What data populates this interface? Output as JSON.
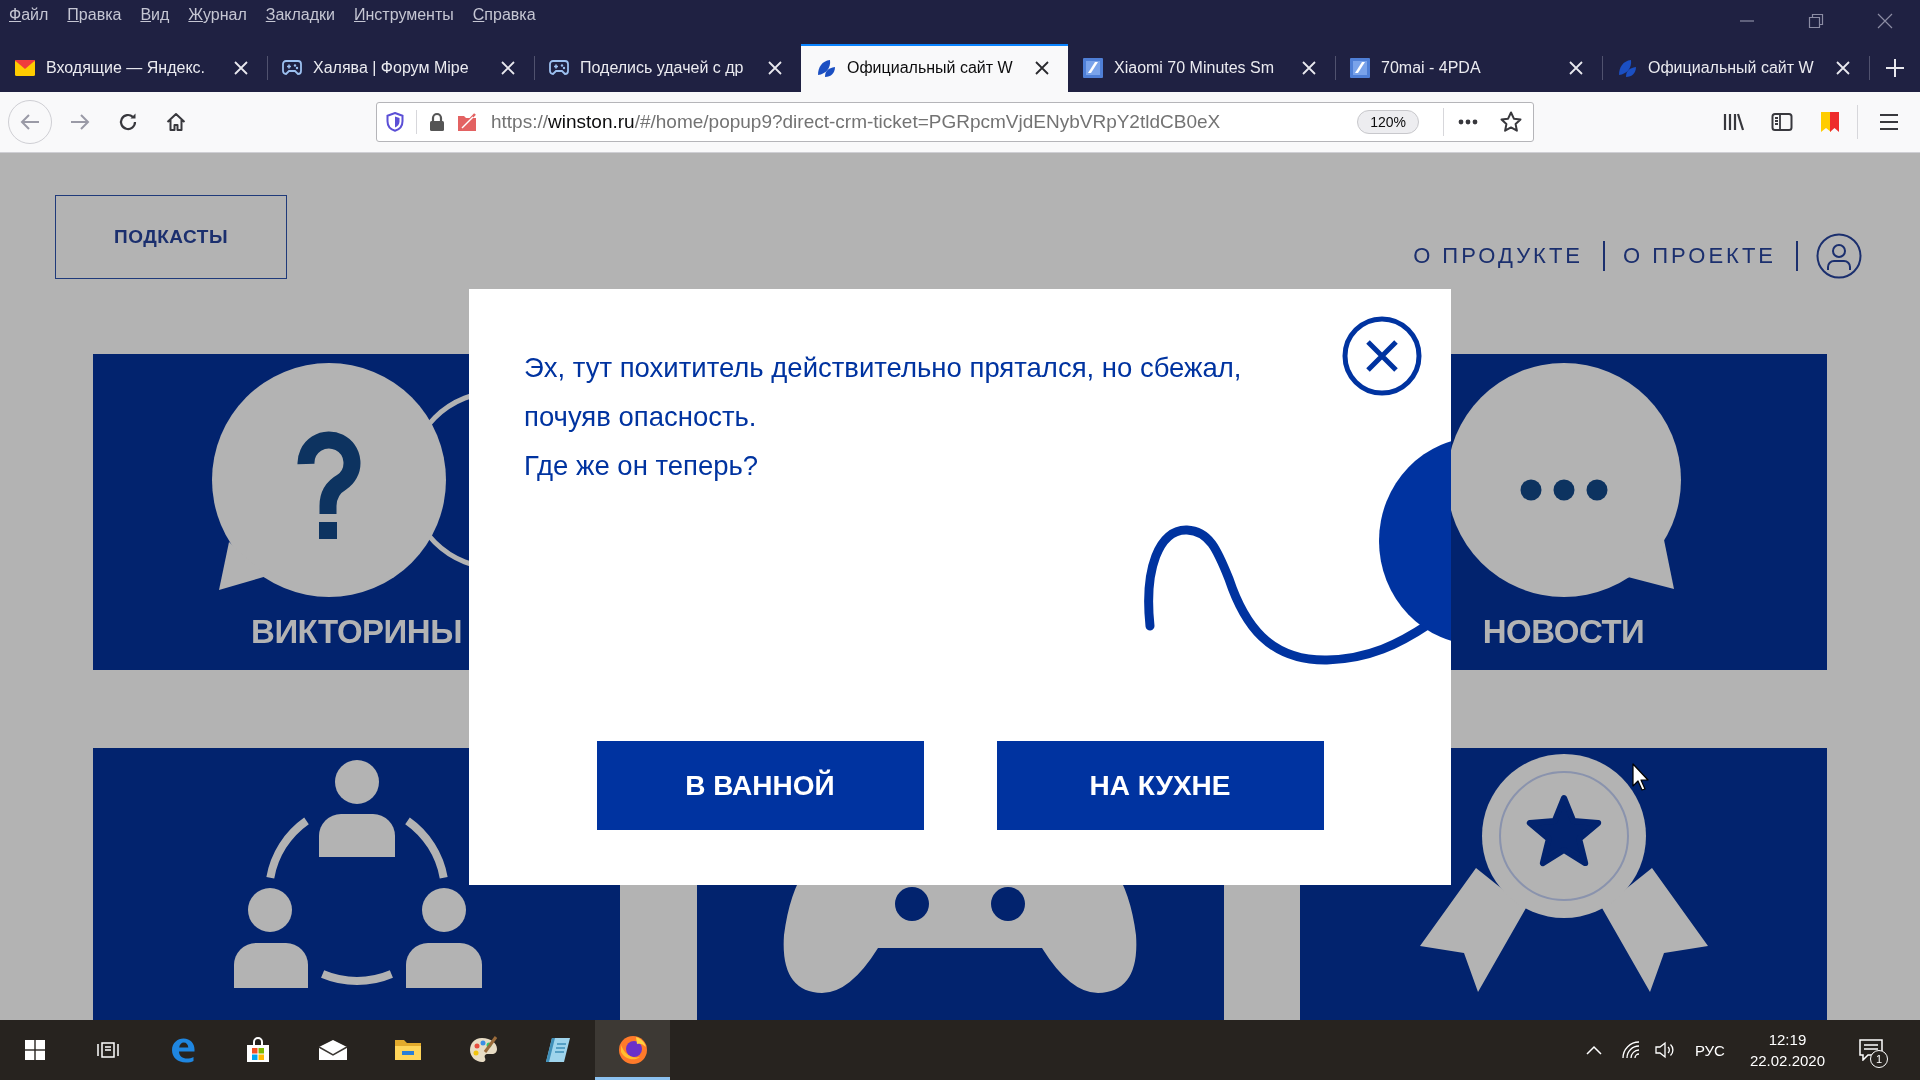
{
  "menu_bar": {
    "items": [
      "Файл",
      "Правка",
      "Вид",
      "Журнал",
      "Закладки",
      "Инструменты",
      "Справка"
    ]
  },
  "tabs": [
    {
      "title": "Входящие — Яндекс.",
      "kind": "mail",
      "selected": false
    },
    {
      "title": "Халява | Форум Mipe",
      "kind": "gamepad",
      "selected": false
    },
    {
      "title": "Поделись удачей с др",
      "kind": "gamepad",
      "selected": false
    },
    {
      "title": "Официальный сайт W",
      "kind": "leaf",
      "selected": true
    },
    {
      "title": "Xiaomi 70 Minutes Sm",
      "kind": "tile",
      "selected": false
    },
    {
      "title": "70mai - 4PDA",
      "kind": "tile",
      "selected": false
    },
    {
      "title": "Официальный сайт W",
      "kind": "leaf",
      "selected": false
    }
  ],
  "toolbar": {
    "url": {
      "scheme": "https://",
      "host": "winston.ru",
      "path": "/#/home/popup9?direct-crm-ticket=PGRpcmVjdENybVRpY2tldCB0eX"
    },
    "zoom": "120%"
  },
  "page": {
    "podcasts_button": "ПОДКАСТЫ",
    "nav_links": [
      "О ПРОДУКТЕ",
      "О ПРОЕКТЕ"
    ],
    "tile_rows": [
      [
        {
          "kind": "quiz",
          "label": "ВИКТОРИНЫ"
        },
        {
          "kind": "news",
          "label": "НОВОСТИ"
        }
      ],
      [
        {
          "kind": "polls"
        },
        {
          "kind": "games"
        },
        {
          "kind": "contests"
        }
      ]
    ]
  },
  "popup": {
    "message": [
      "Эх, тут похититель действительно прятался, но сбежал, почуяв опасность.",
      "Где же он теперь?"
    ],
    "buttons": [
      "В ВАННОЙ",
      "НА КУХНЕ"
    ]
  },
  "taskbar": {
    "apps": [
      {
        "kind": "start",
        "active": false
      },
      {
        "kind": "task_view",
        "active": false
      },
      {
        "kind": "edge",
        "active": false
      },
      {
        "kind": "store",
        "active": false
      },
      {
        "kind": "mail",
        "active": false
      },
      {
        "kind": "explorer",
        "active": false
      },
      {
        "kind": "paint",
        "active": false
      },
      {
        "kind": "notebook",
        "active": false
      },
      {
        "kind": "firefox",
        "active": true
      }
    ],
    "language": "РУС",
    "time": "12:19",
    "date": "22.02.2020",
    "notifications": "1"
  }
}
